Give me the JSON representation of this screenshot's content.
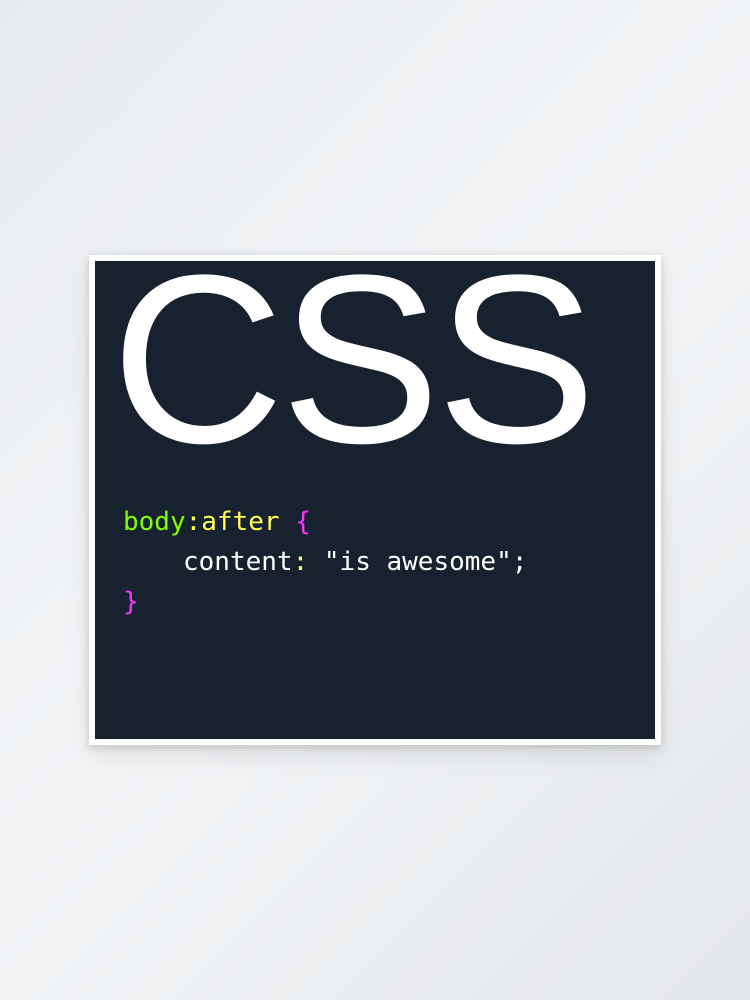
{
  "poster": {
    "title": "CSS",
    "code": {
      "selector": "body",
      "pseudo_colon": ":",
      "pseudo": "after",
      "space1": " ",
      "open_brace": "{",
      "property": "content",
      "prop_colon": ":",
      "space2": " ",
      "value": "\"is awesome\"",
      "semicolon": ";",
      "close_brace": "}"
    }
  }
}
